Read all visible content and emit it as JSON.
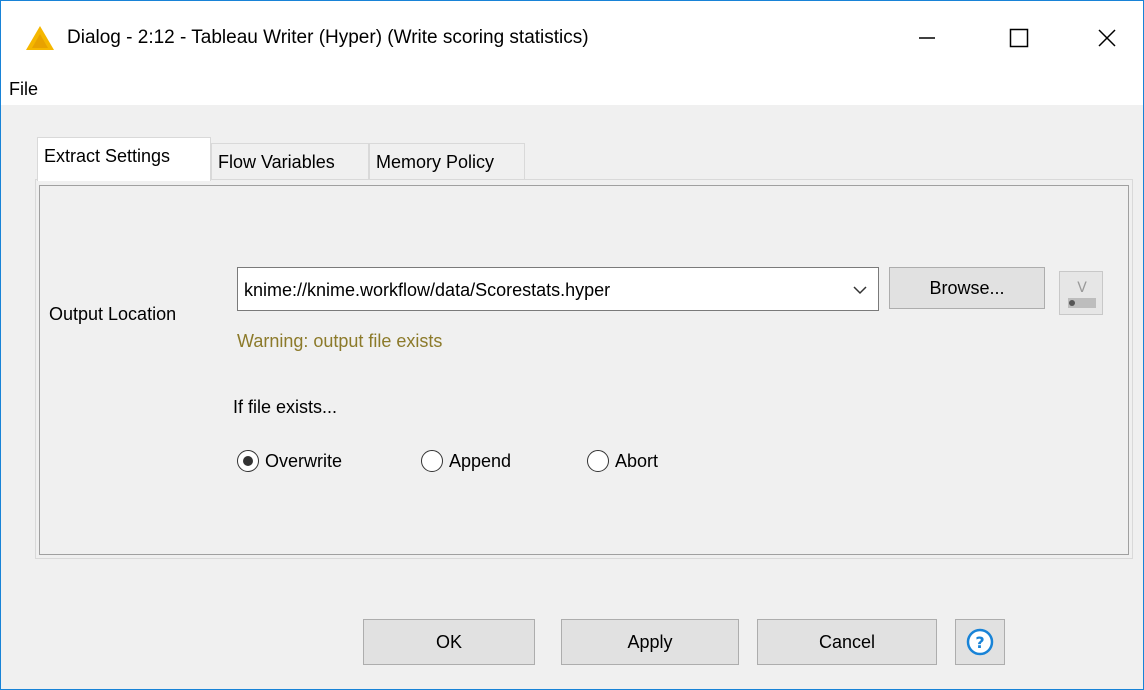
{
  "window": {
    "title": "Dialog - 2:12 - Tableau Writer (Hyper) (Write scoring statistics)",
    "icon": "warning-triangle-icon",
    "controls": [
      "minimize-icon",
      "maximize-icon",
      "close-icon"
    ]
  },
  "menu": {
    "file_label": "File"
  },
  "tabs": [
    {
      "label": "Extract Settings",
      "active": true
    },
    {
      "label": "Flow Variables",
      "active": false
    },
    {
      "label": "Memory Policy",
      "active": false
    }
  ],
  "extract_settings": {
    "output_location_label": "Output Location",
    "output_location_value": "knime://knime.workflow/data/Scorestats.hyper",
    "browse_label": "Browse...",
    "warning_text": "Warning: output file exists",
    "if_file_exists_label": "If file exists...",
    "options": [
      {
        "label": "Overwrite",
        "selected": true
      },
      {
        "label": "Append",
        "selected": false
      },
      {
        "label": "Abort",
        "selected": false
      }
    ]
  },
  "buttons": {
    "ok": "OK",
    "apply": "Apply",
    "cancel": "Cancel",
    "help_icon": "help-icon"
  },
  "colors": {
    "accent": "#1883d7",
    "warning_text": "#8c7a2a",
    "title_icon": "#f5b700"
  }
}
